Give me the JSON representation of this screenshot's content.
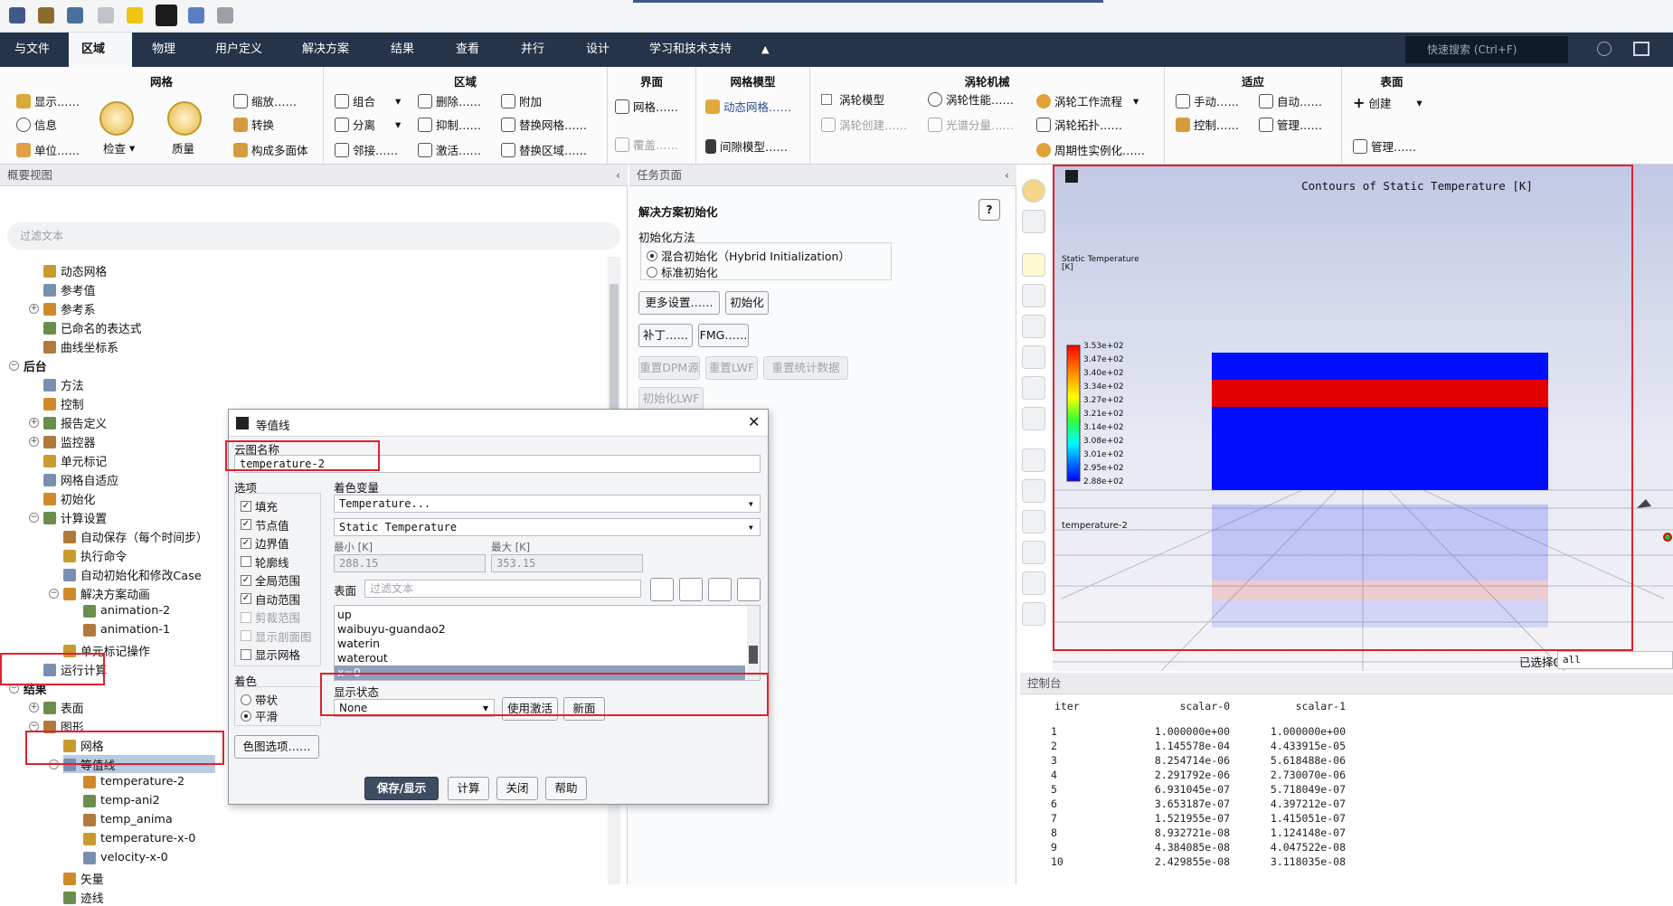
{
  "menubar": {
    "tabs": [
      "与文件",
      "区域",
      "物理",
      "用户定义",
      "解决方案",
      "结果",
      "查看",
      "并行",
      "设计",
      "学习和技术支持"
    ],
    "active_tab": "区域",
    "search_placeholder": "快速搜索 (Ctrl+F)"
  },
  "ribbon": {
    "mesh": {
      "title": "网格",
      "display": "显示……",
      "info": "信息",
      "units": "单位……",
      "check": "检查",
      "quality": "质量",
      "scale": "缩放……",
      "transform": "转换",
      "make_polyhedra": "构成多面体"
    },
    "zone": {
      "title": "区域",
      "combine": "组合",
      "separate": "分离",
      "adjacency": "邻接……",
      "delete": "删除……",
      "deactivate": "抑制……",
      "activate": "激活……",
      "append": "附加",
      "replace_mesh": "替换网格……",
      "replace_zone": "替换区域……"
    },
    "interface": {
      "title": "界面",
      "mesh": "网格……",
      "overset": "覆盖……"
    },
    "mesh_models": {
      "title": "网格模型",
      "dynamic_mesh": "动态网格……",
      "gap_model": "间隙模型……"
    },
    "turbomachinery": {
      "title": "涡轮机械",
      "turbo_model": "涡轮模型",
      "turbo_create": "涡轮创建……",
      "turbo_performance": "涡轮性能……",
      "spectral": "光谱分量……",
      "turbo_workflow": "涡轮工作流程",
      "turbo_topology": "涡轮拓扑……",
      "periodic_instancing": "周期性实例化……"
    },
    "adapt": {
      "title": "适应",
      "manual": "手动……",
      "automatic": "自动……",
      "controls": "控制……",
      "manage": "管理……"
    },
    "surface": {
      "title": "表面",
      "create": "创建",
      "manage": "管理……"
    }
  },
  "outline": {
    "header": "概要视图",
    "filter_placeholder": "过滤文本",
    "items": [
      {
        "label": "动态网格",
        "indent": 1,
        "tog": ""
      },
      {
        "label": "参考值",
        "indent": 1,
        "tog": ""
      },
      {
        "label": "参考系",
        "indent": 1,
        "tog": "+"
      },
      {
        "label": "已命名的表达式",
        "indent": 1,
        "tog": ""
      },
      {
        "label": "曲线坐标系",
        "indent": 1,
        "tog": ""
      },
      {
        "label": "后台",
        "indent": 0,
        "tog": "−",
        "bold": true
      },
      {
        "label": "方法",
        "indent": 1,
        "tog": ""
      },
      {
        "label": "控制",
        "indent": 1,
        "tog": ""
      },
      {
        "label": "报告定义",
        "indent": 1,
        "tog": "+"
      },
      {
        "label": "监控器",
        "indent": 1,
        "tog": "+"
      },
      {
        "label": "单元标记",
        "indent": 1,
        "tog": ""
      },
      {
        "label": "网格自适应",
        "indent": 1,
        "tog": ""
      },
      {
        "label": "初始化",
        "indent": 1,
        "tog": ""
      },
      {
        "label": "计算设置",
        "indent": 1,
        "tog": "−"
      },
      {
        "label": "自动保存（每个时间步）",
        "indent": 2,
        "tog": ""
      },
      {
        "label": "执行命令",
        "indent": 2,
        "tog": ""
      },
      {
        "label": "自动初始化和修改Case",
        "indent": 2,
        "tog": ""
      },
      {
        "label": "解决方案动画",
        "indent": 2,
        "tog": "−"
      },
      {
        "label": "animation-2",
        "indent": 3,
        "tog": ""
      },
      {
        "label": "animation-1",
        "indent": 3,
        "tog": ""
      },
      {
        "label": "单元标记操作",
        "indent": 2,
        "tog": ""
      },
      {
        "label": "运行计算",
        "indent": 1,
        "tog": ""
      },
      {
        "label": "结果",
        "indent": 0,
        "tog": "−",
        "bold": true
      },
      {
        "label": "表面",
        "indent": 1,
        "tog": "+"
      },
      {
        "label": "图形",
        "indent": 1,
        "tog": "−"
      },
      {
        "label": "网格",
        "indent": 2,
        "tog": ""
      },
      {
        "label": "等值线",
        "indent": 2,
        "tog": "−",
        "selected": true
      },
      {
        "label": "temperature-2",
        "indent": 3,
        "tog": ""
      },
      {
        "label": "temp-ani2",
        "indent": 3,
        "tog": ""
      },
      {
        "label": "temp_anima",
        "indent": 3,
        "tog": ""
      },
      {
        "label": "temperature-x-0",
        "indent": 3,
        "tog": ""
      },
      {
        "label": "velocity-x-0",
        "indent": 3,
        "tog": ""
      },
      {
        "label": "矢量",
        "indent": 2,
        "tog": ""
      },
      {
        "label": "迹线",
        "indent": 2,
        "tog": ""
      }
    ]
  },
  "task_page": {
    "header": "任务页面",
    "title": "解决方案初始化",
    "method_label": "初始化方法",
    "hybrid": "混合初始化（Hybrid Initialization）",
    "standard": "标准初始化",
    "more_settings": "更多设置……",
    "initialize": "初始化",
    "patch": "补丁……",
    "fmg": "FMG……",
    "reset_dpm": "重置DPM源",
    "reset_lwf": "重置LWF",
    "reset_stats": "重置统计数据",
    "init_lwf": "初始化LWF"
  },
  "dialog": {
    "title": "等值线",
    "name_label": "云图名称",
    "name_value": "temperature-2",
    "options_label": "选项",
    "options": [
      {
        "label": "填充",
        "checked": true,
        "disabled": false
      },
      {
        "label": "节点值",
        "checked": true,
        "disabled": false
      },
      {
        "label": "边界值",
        "checked": true,
        "disabled": false
      },
      {
        "label": "轮廓线",
        "checked": false,
        "disabled": false
      },
      {
        "label": "全局范围",
        "checked": true,
        "disabled": false
      },
      {
        "label": "自动范围",
        "checked": true,
        "disabled": false
      },
      {
        "label": "剪裁范围",
        "checked": false,
        "disabled": true
      },
      {
        "label": "显示剖面图",
        "checked": false,
        "disabled": true
      },
      {
        "label": "显示网格",
        "checked": false,
        "disabled": false
      }
    ],
    "coloring_label": "着色",
    "banded": "带状",
    "smooth": "平滑",
    "colormap_options": "色图选项……",
    "color_variable_label": "着色变量",
    "variable_category": "Temperature...",
    "variable": "Static Temperature",
    "min_label": "最小 [K]",
    "max_label": "最大 [K]",
    "min_value": "288.15",
    "max_value": "353.15",
    "surfaces_label": "表面",
    "surface_filter_placeholder": "过滤文本",
    "surfaces": [
      "up",
      "waibuyu-guandao2",
      "waterin",
      "waterout",
      "x=0"
    ],
    "selected_surface": "x=0",
    "display_state_label": "显示状态",
    "display_state_value": "None",
    "use_active": "使用激活",
    "new": "新面",
    "save_display": "保存/显示",
    "compute": "计算",
    "close": "关闭",
    "help": "帮助"
  },
  "graphics": {
    "title": "Contours of Static Temperature [K]",
    "legend_title": "Static Temperature",
    "legend_unit": "[K]",
    "legend_ticks": [
      "3.53e+02",
      "3.47e+02",
      "3.40e+02",
      "3.34e+02",
      "3.27e+02",
      "3.21e+02",
      "3.14e+02",
      "3.08e+02",
      "3.01e+02",
      "2.95e+02",
      "2.88e+02"
    ],
    "object_name": "temperature-2",
    "selected_label": "已选择0",
    "selected_value": "all"
  },
  "console": {
    "header": "控制台",
    "columns": [
      "iter",
      "scalar-0",
      "scalar-1"
    ],
    "rows": [
      [
        "1",
        "1.000000e+00",
        "1.000000e+00"
      ],
      [
        "2",
        "1.145578e-04",
        "4.433915e-05"
      ],
      [
        "3",
        "8.254714e-06",
        "5.618488e-06"
      ],
      [
        "4",
        "2.291792e-06",
        "2.730070e-06"
      ],
      [
        "5",
        "6.931045e-07",
        "5.718049e-07"
      ],
      [
        "6",
        "3.653187e-07",
        "4.397212e-07"
      ],
      [
        "7",
        "1.521955e-07",
        "1.415051e-07"
      ],
      [
        "8",
        "8.932721e-08",
        "1.124148e-07"
      ],
      [
        "9",
        "4.384085e-08",
        "4.047522e-08"
      ],
      [
        "10",
        "2.429855e-08",
        "3.118035e-08"
      ]
    ]
  },
  "colors": {
    "accent": "#26344a",
    "highlight": "#e2202c",
    "selection": "#b9cbe2"
  }
}
